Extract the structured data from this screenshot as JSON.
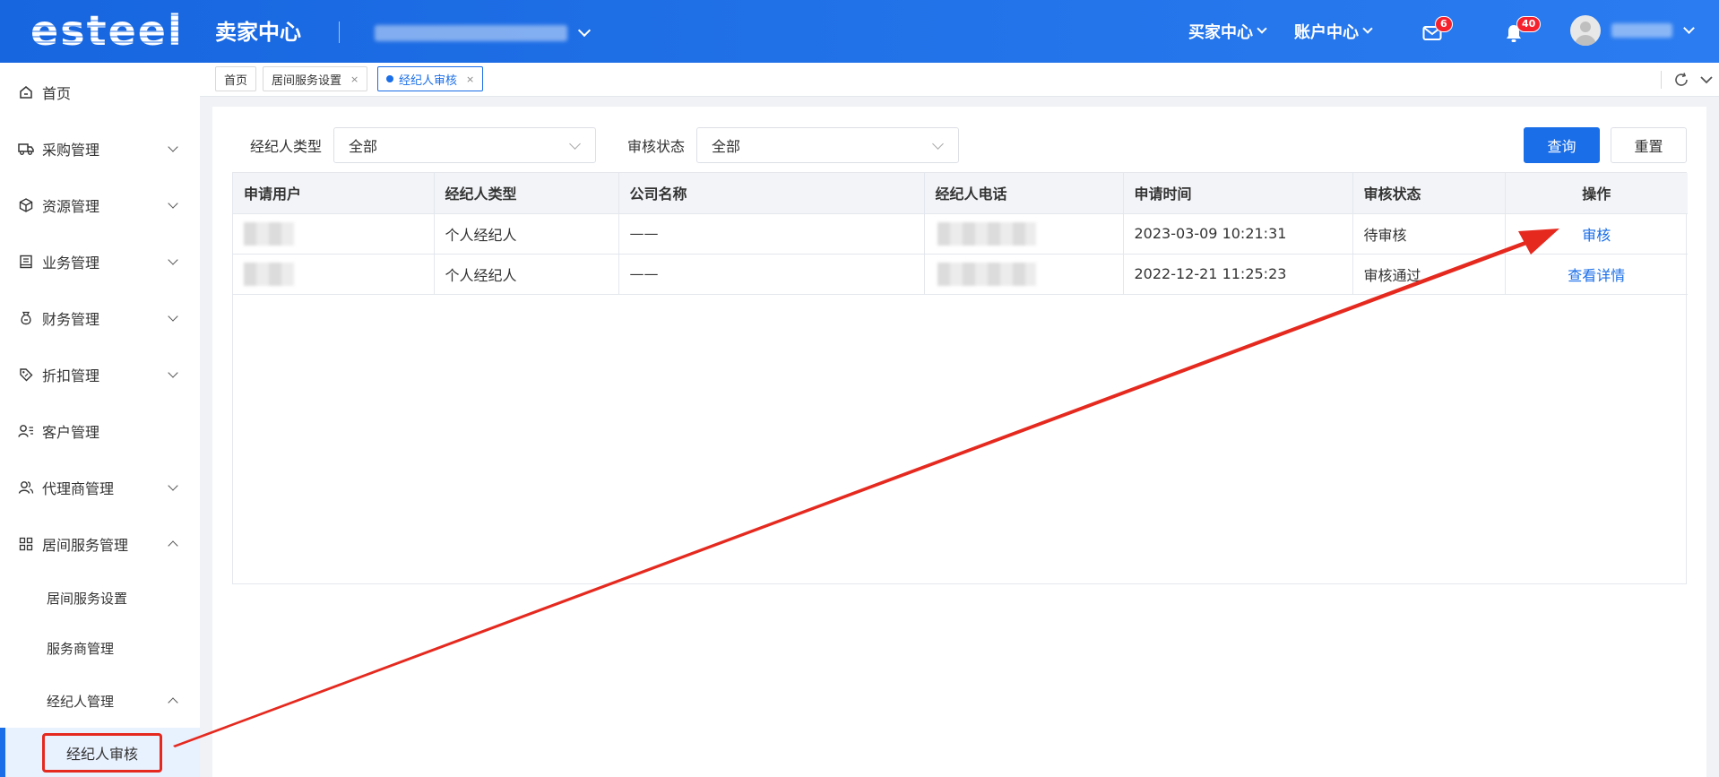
{
  "header": {
    "brand": "esteel",
    "app_title": "卖家中心",
    "nav": [
      {
        "label": "买家中心"
      },
      {
        "label": "账户中心"
      }
    ],
    "mail_badge": "6",
    "bell_badge": "40"
  },
  "sidebar": {
    "items": [
      {
        "label": "首页",
        "icon": "home-icon"
      },
      {
        "label": "采购管理",
        "icon": "truck-icon"
      },
      {
        "label": "资源管理",
        "icon": "cube-icon"
      },
      {
        "label": "业务管理",
        "icon": "book-icon"
      },
      {
        "label": "财务管理",
        "icon": "money-bag-icon"
      },
      {
        "label": "折扣管理",
        "icon": "tag-icon"
      },
      {
        "label": "客户管理",
        "icon": "user-list-icon"
      },
      {
        "label": "代理商管理",
        "icon": "users-icon"
      },
      {
        "label": "居间服务管理",
        "icon": "grid-icon"
      }
    ],
    "sub_items": [
      {
        "label": "居间服务设置"
      },
      {
        "label": "服务商管理"
      },
      {
        "label": "经纪人管理"
      }
    ],
    "active_item": "经纪人审核"
  },
  "tabs": [
    {
      "label": "首页"
    },
    {
      "label": "居间服务设置",
      "close": "×"
    },
    {
      "label": "经纪人审核",
      "close": "×"
    }
  ],
  "filters": {
    "broker_type_label": "经纪人类型",
    "broker_type_value": "全部",
    "review_status_label": "审核状态",
    "review_status_value": "全部",
    "query_button": "查询",
    "reset_button": "重置"
  },
  "table": {
    "columns": [
      "申请用户",
      "经纪人类型",
      "公司名称",
      "经纪人电话",
      "申请时间",
      "审核状态",
      "操作"
    ],
    "rows": [
      {
        "type": "个人经纪人",
        "company": "——",
        "time": "2023-03-09 10:21:31",
        "status": "待审核",
        "action": "审核"
      },
      {
        "type": "个人经纪人",
        "company": "——",
        "time": "2022-12-21 11:25:23",
        "status": "审核通过",
        "action": "查看详情"
      }
    ]
  },
  "colors": {
    "primary": "#1a6ee8",
    "annotation": "#e5291f"
  }
}
